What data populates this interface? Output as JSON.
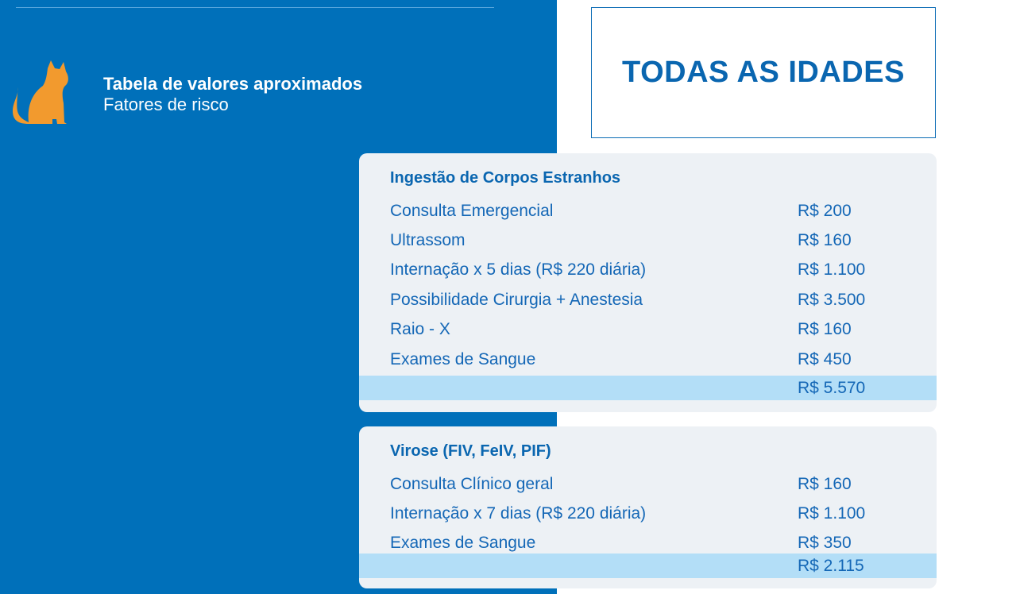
{
  "header": {
    "title": "Tabela de valores aproximados",
    "subtitle": "Fatores de risco",
    "icon": "cat-icon",
    "icon_color": "#f29a2e"
  },
  "age_group": "TODAS AS IDADES",
  "colors": {
    "panel_blue": "#0070ba",
    "card_background": "#edf1f5",
    "total_highlight": "#b3def7",
    "text_blue": "#1467b6"
  },
  "sections": [
    {
      "title": "Ingestão de Corpos Estranhos",
      "rows": [
        {
          "item": "Consulta Emergencial",
          "price": "R$ 200"
        },
        {
          "item": "Ultrassom",
          "price": "R$ 160"
        },
        {
          "item": "Internação x 5 dias (R$ 220 diária)",
          "price": "R$ 1.100"
        },
        {
          "item": "Possibilidade Cirurgia + Anestesia",
          "price": "R$ 3.500"
        },
        {
          "item": "Raio - X",
          "price": "R$ 160"
        },
        {
          "item": "Exames de Sangue",
          "price": "R$ 450"
        }
      ],
      "total": "R$ 5.570"
    },
    {
      "title": "Virose (FIV, FeIV, PIF)",
      "rows": [
        {
          "item": "Consulta Clínico geral",
          "price": "R$ 160"
        },
        {
          "item": "Internação x 7 dias (R$ 220 diária)",
          "price": "R$ 1.100"
        },
        {
          "item": "Exames de Sangue",
          "price": "R$ 350"
        }
      ],
      "total": "R$ 2.115"
    }
  ]
}
